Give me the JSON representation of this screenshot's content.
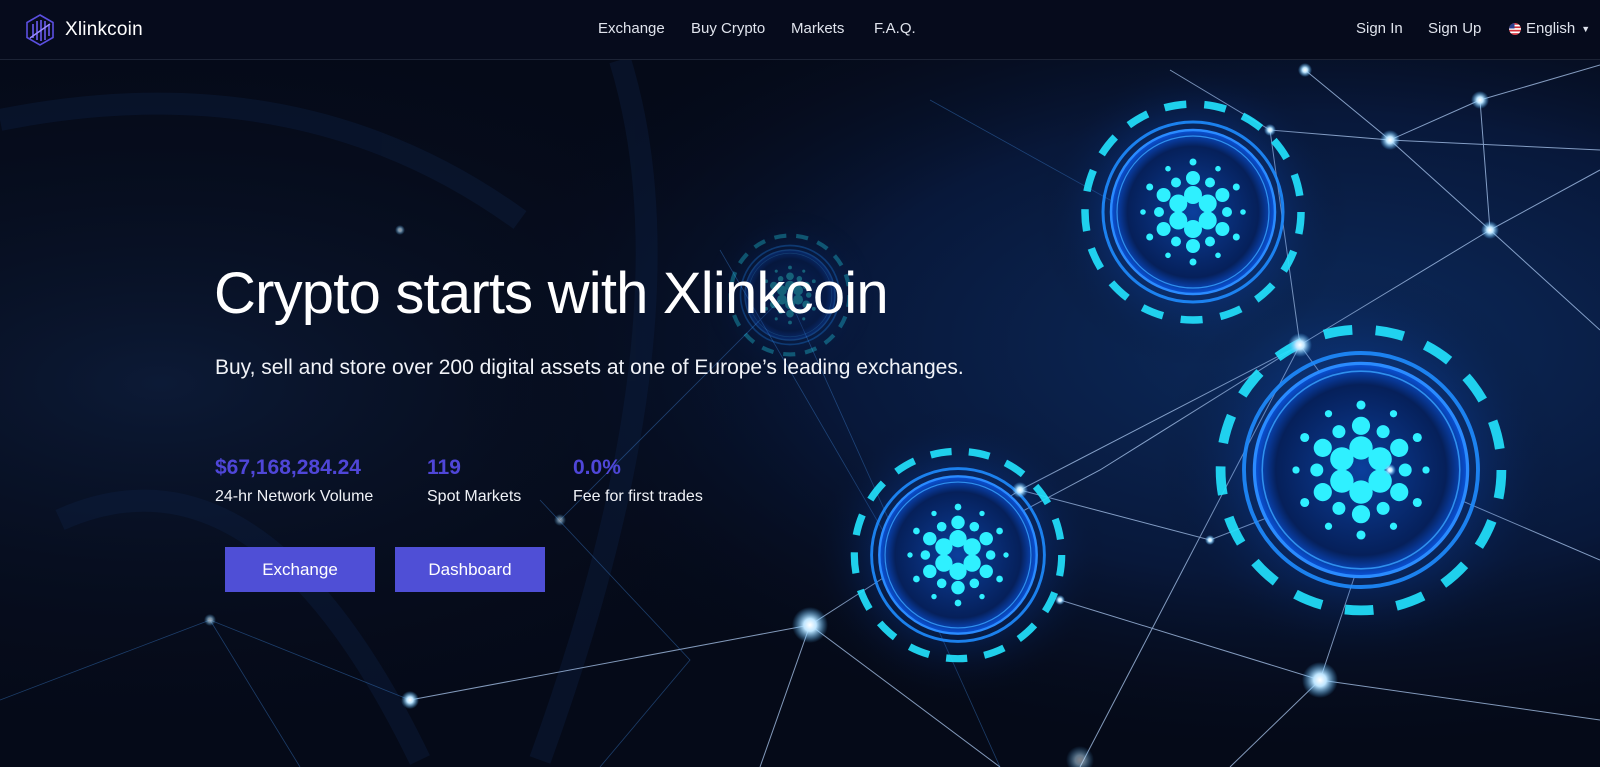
{
  "brand": {
    "name": "Xlinkcoin"
  },
  "nav": {
    "links": [
      "Exchange",
      "Buy Crypto",
      "Markets",
      "F.A.Q."
    ],
    "sign_in": "Sign In",
    "sign_up": "Sign Up",
    "language": "English"
  },
  "hero": {
    "title": "Crypto starts with Xlinkcoin",
    "subtitle": "Buy, sell and store over 200 digital assets at one of Europe’s leading exchanges.",
    "stats": [
      {
        "value": "$67,168,284.24",
        "label": "24-hr Network Volume"
      },
      {
        "value": "119",
        "label": "Spot Markets"
      },
      {
        "value": "0.0%",
        "label": "Fee for first trades"
      }
    ],
    "buttons": {
      "exchange": "Exchange",
      "dashboard": "Dashboard"
    }
  },
  "colors": {
    "page_bg": "#050a18",
    "nav_bg": "#060b1c",
    "accent": "#4f4fd6",
    "stat_value": "#4f46d8",
    "glow": "#22e4ff"
  },
  "icons": {
    "logo": "xlinkcoin-logo-icon",
    "flag": "us-flag-icon",
    "chevron": "chevron-down-icon",
    "coin": "cardano-coin-icon"
  }
}
